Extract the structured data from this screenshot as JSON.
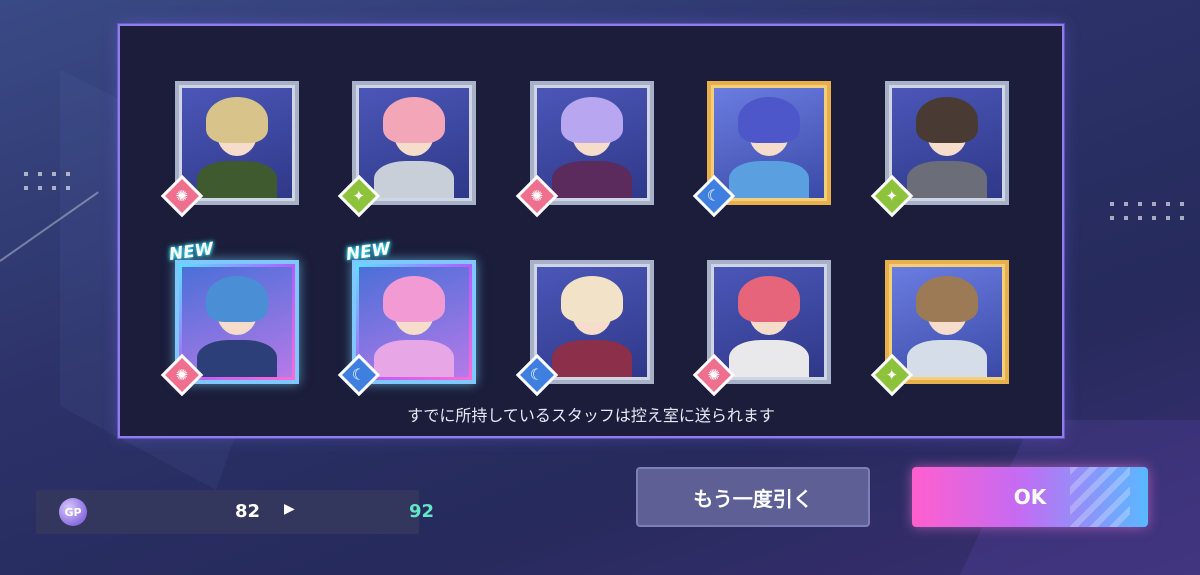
{
  "gacha_result": {
    "notice": "すでに所持しているスタッフは控え室に送られます",
    "new_label": "NEW",
    "cards": [
      {
        "attribute": "sun",
        "rarity": "normal",
        "is_new": false,
        "hair": "#d8c48a",
        "outfit": "#3f5a2e"
      },
      {
        "attribute": "star",
        "rarity": "normal",
        "is_new": false,
        "hair": "#f2a6b8",
        "outfit": "#c9cfd9"
      },
      {
        "attribute": "sun",
        "rarity": "normal",
        "is_new": false,
        "hair": "#b8a6f0",
        "outfit": "#5b2b5e"
      },
      {
        "attribute": "moon",
        "rarity": "gold",
        "is_new": false,
        "hair": "#4d57c9",
        "outfit": "#5a9fe0"
      },
      {
        "attribute": "star",
        "rarity": "normal",
        "is_new": false,
        "hair": "#4a3a34",
        "outfit": "#6b6e78"
      },
      {
        "attribute": "sun",
        "rarity": "holo",
        "is_new": true,
        "hair": "#4a8fd6",
        "outfit": "#2c3f78"
      },
      {
        "attribute": "moon",
        "rarity": "holo",
        "is_new": true,
        "hair": "#f19ad3",
        "outfit": "#e7a6e6"
      },
      {
        "attribute": "moon",
        "rarity": "normal",
        "is_new": false,
        "hair": "#f2e2c8",
        "outfit": "#8c2f4a"
      },
      {
        "attribute": "sun",
        "rarity": "normal",
        "is_new": false,
        "hair": "#e6657a",
        "outfit": "#e9e9ec"
      },
      {
        "attribute": "star",
        "rarity": "gold",
        "is_new": false,
        "hair": "#9c7a55",
        "outfit": "#d5dde8"
      }
    ]
  },
  "gp": {
    "icon_label": "GP",
    "before": "82",
    "after": "92"
  },
  "buttons": {
    "draw_again": "もう一度引く",
    "ok": "OK"
  },
  "icons": {
    "sun": "sun-attribute-icon",
    "star": "star-attribute-icon",
    "moon": "moon-attribute-icon",
    "arrow": "right-arrow-icon"
  }
}
